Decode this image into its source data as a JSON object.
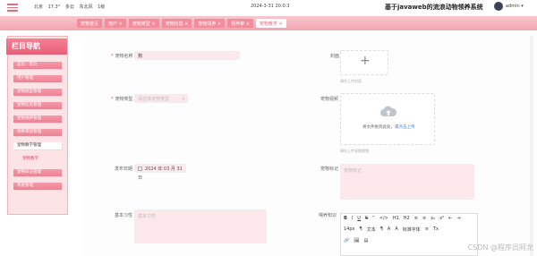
{
  "header": {
    "weather": {
      "city": "北京",
      "temp": "17.3°",
      "condition": "多云",
      "wind": "东北风",
      "level": "1级"
    },
    "datetime": "2024-3-31 20:0:3",
    "system_title": "基于javaweb的流浪动物领养系统",
    "username": "admin",
    "menu_icon": "hamburger-icon"
  },
  "nav": {
    "tabs": [
      {
        "label": "宠物首页"
      },
      {
        "label": "用户 ×"
      },
      {
        "label": "宠物类型 ×"
      },
      {
        "label": "宠物信息 ×"
      },
      {
        "label": "宠物领养 ×"
      },
      {
        "label": "领养审 ×"
      },
      {
        "label": "宠物教学 ×"
      }
    ],
    "active_index": 6
  },
  "sidebar": {
    "title": "栏目导航",
    "items": [
      {
        "label": "首页 · 首页"
      },
      {
        "label": "用户管理"
      },
      {
        "label": "宠物类型管理"
      },
      {
        "label": "宠物信息管理"
      },
      {
        "label": "宠物领养管理"
      },
      {
        "label": "领养审核管理"
      },
      {
        "label": "宠物教学管理"
      },
      {
        "label": "宠物教学"
      },
      {
        "label": "宠物日记管理"
      },
      {
        "label": "系统管理"
      }
    ]
  },
  "form": {
    "pet_name": {
      "label": "宠物名称",
      "value": "狗"
    },
    "pet_type": {
      "label": "宠物类型",
      "placeholder": "请选择宠物类型"
    },
    "cover": {
      "label": "封面",
      "hint": "请先上传封面"
    },
    "pet_video": {
      "label": "宠物视频",
      "drop_text": "将文件拖到此处，或",
      "drop_link": "点击上传",
      "hint": "请先上传宠物视频"
    },
    "publish_date": {
      "label": "发布日期",
      "value": "2024 年 03 月 31 日"
    },
    "pet_notes": {
      "label": "宠物标记",
      "placeholder": "宠物标记"
    },
    "basic_habits": {
      "label": "基本习性",
      "placeholder": "基本习性"
    },
    "feeding_knowledge": {
      "label": "喂养知识"
    }
  },
  "editor": {
    "row1": [
      "B",
      "I",
      "U",
      "S",
      "”",
      "</>",
      "H1",
      "H2",
      "≡",
      "≡",
      "x₂",
      "x²",
      "⇤",
      "⇥"
    ],
    "row2": [
      "14px",
      "¶",
      "文本",
      "¶",
      "A",
      "A",
      "标准字体",
      "≡",
      "Tx"
    ],
    "row3": [
      "🔗",
      "🖼",
      "▤"
    ]
  },
  "watermark": "CSDN @程序员阿龙"
}
